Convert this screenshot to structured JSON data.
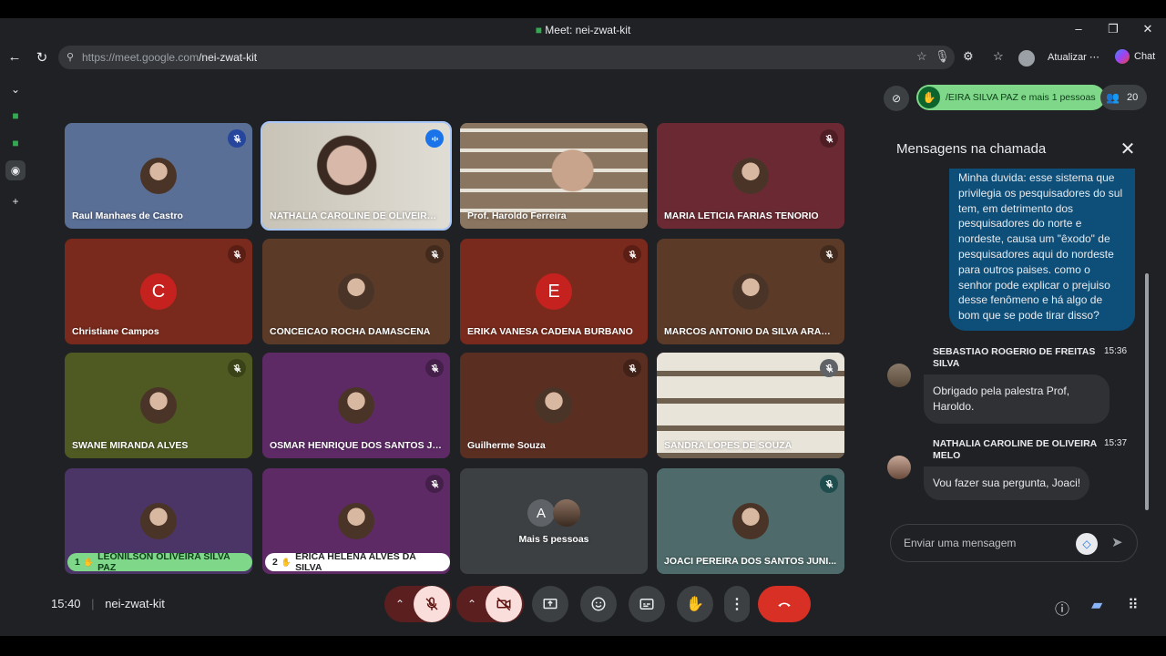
{
  "browser": {
    "title": "Meet: nei-zwat-kit",
    "url_host": "https://meet.google.com",
    "url_path": "/nei-zwat-kit",
    "update_label": "Atualizar",
    "chat_label": "Chat"
  },
  "topbar": {
    "raised_hands_label": "/EIRA SILVA PAZ e mais 1 pessoas",
    "participant_count": "20"
  },
  "tiles": [
    {
      "name": "Raul Manhaes de Castro",
      "bg": "#5a6f96",
      "muted": true,
      "mic_bg": "#25469c"
    },
    {
      "name": "NATHALIA CAROLINE DE OLIVEIRA ...",
      "bg": "#c9c0b3",
      "muted": false,
      "speaking": true,
      "mic_bg": "#1a73e8"
    },
    {
      "name": "Prof. Haroldo Ferreira",
      "bg": "#7a6a55",
      "muted": false
    },
    {
      "name": "MARIA LETICIA FARIAS TENORIO",
      "bg": "#6b2a33",
      "muted": true,
      "mic_bg": "#4f1e25"
    },
    {
      "name": "Christiane Campos",
      "bg": "#7a2a1c",
      "muted": true,
      "mic_bg": "#5a1e14",
      "initial": "C",
      "initial_bg": "#c5221f"
    },
    {
      "name": "CONCEICAO ROCHA DAMASCENA",
      "bg": "#5b3a28",
      "muted": true,
      "mic_bg": "#422a1d"
    },
    {
      "name": "ERIKA VANESA CADENA BURBANO",
      "bg": "#7a2a1c",
      "muted": true,
      "mic_bg": "#5a1e14",
      "initial": "E",
      "initial_bg": "#c5221f"
    },
    {
      "name": "MARCOS ANTONIO DA SILVA ARAUJ...",
      "bg": "#5b3a28",
      "muted": true,
      "mic_bg": "#422a1d"
    },
    {
      "name": "SWANE MIRANDA ALVES",
      "bg": "#4f5a22",
      "muted": true,
      "mic_bg": "#3a4218"
    },
    {
      "name": "OSMAR HENRIQUE DOS SANTOS JU...",
      "bg": "#5d2a66",
      "muted": true,
      "mic_bg": "#441f4a"
    },
    {
      "name": "Guilherme Souza",
      "bg": "#5b2e22",
      "muted": true,
      "mic_bg": "#422118"
    },
    {
      "name": "SANDRA LOPES DE SOUZA",
      "bg": "#d6d1c7",
      "muted": true,
      "mic_bg": "#5f6368"
    },
    {
      "name": "LEONILSON OLIVEIRA SILVA PAZ",
      "bg": "#4a3566",
      "muted": false,
      "hand": "1",
      "hand_bg": "#7fd88a",
      "hand_fg": "#0d3d17"
    },
    {
      "name": "ERICA HELENA ALVES DA SILVA",
      "bg": "#5d2a66",
      "muted": true,
      "mic_bg": "#441f4a",
      "hand": "2",
      "hand_bg": "#ffffff",
      "hand_fg": "#202124"
    },
    {
      "name": "Mais 5 pessoas",
      "bg": "#3c4043",
      "muted": false,
      "more": true,
      "initial": "A"
    },
    {
      "name": "JOACI PEREIRA DOS SANTOS JUNI...",
      "bg": "#4e6a6a",
      "muted": true,
      "mic_bg": "#1f4d4d"
    }
  ],
  "footer": {
    "time": "15:40",
    "meeting_code": "nei-zwat-kit"
  },
  "chat": {
    "title": "Mensagens na chamada",
    "my_message": "Minha duvida: esse sistema que privilegia os pesquisadores do sul tem, em detrimento dos pesquisadores do norte e nordeste, causa um \"êxodo\" de pesquisadores aqui do nordeste para outros paises. como o senhor pode explicar o prejuiso desse fenômeno e há algo de bom que se pode tirar disso?",
    "messages": [
      {
        "sender": "SEBASTIAO ROGERIO DE FREITAS SILVA",
        "time": "15:36",
        "text": "Obrigado pela palestra Prof, Haroldo."
      },
      {
        "sender": "NATHALIA CAROLINE DE OLIVEIRA MELO",
        "time": "15:37",
        "text": "Vou fazer sua pergunta, Joaci!"
      }
    ],
    "input_placeholder": "Enviar uma mensagem"
  },
  "colors": {
    "hand_raise_green": "#7fd88a",
    "end_call_red": "#d93025",
    "muted_control": "#f9dedc",
    "my_bubble": "#0e4f7a"
  }
}
